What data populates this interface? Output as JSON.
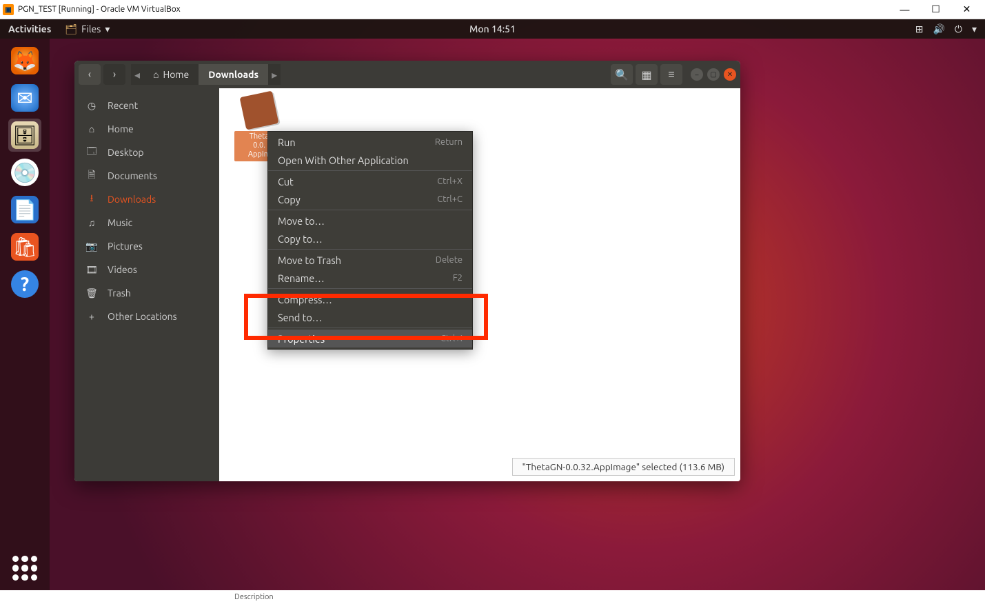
{
  "window": {
    "title": "PGN_TEST [Running] - Oracle VM VirtualBox"
  },
  "topbar": {
    "activities": "Activities",
    "files_label": "Files",
    "clock": "Mon 14:51"
  },
  "fm": {
    "breadcrumb": {
      "home": "Home",
      "current": "Downloads"
    },
    "sidebar": {
      "recent": "Recent",
      "home": "Home",
      "desktop": "Desktop",
      "documents": "Documents",
      "downloads": "Downloads",
      "music": "Music",
      "pictures": "Pictures",
      "videos": "Videos",
      "trash": "Trash",
      "other": "Other Locations"
    },
    "file": {
      "line1": "Theta",
      "line2": "0.0.",
      "line3": "AppIm"
    },
    "status": "\"ThetaGN-0.0.32.AppImage\" selected  (113.6 MB)"
  },
  "ctx": {
    "run": "Run",
    "run_sc": "Return",
    "open_other": "Open With Other Application",
    "cut": "Cut",
    "cut_sc": "Ctrl+X",
    "copy": "Copy",
    "copy_sc": "Ctrl+C",
    "move_to": "Move to…",
    "copy_to": "Copy to…",
    "trash": "Move to Trash",
    "trash_sc": "Delete",
    "rename": "Rename…",
    "rename_sc": "F2",
    "compress": "Compress…",
    "send": "Send to…",
    "props": "Properties",
    "props_sc": "Ctrl+I"
  },
  "bottom": {
    "text": "Description"
  }
}
